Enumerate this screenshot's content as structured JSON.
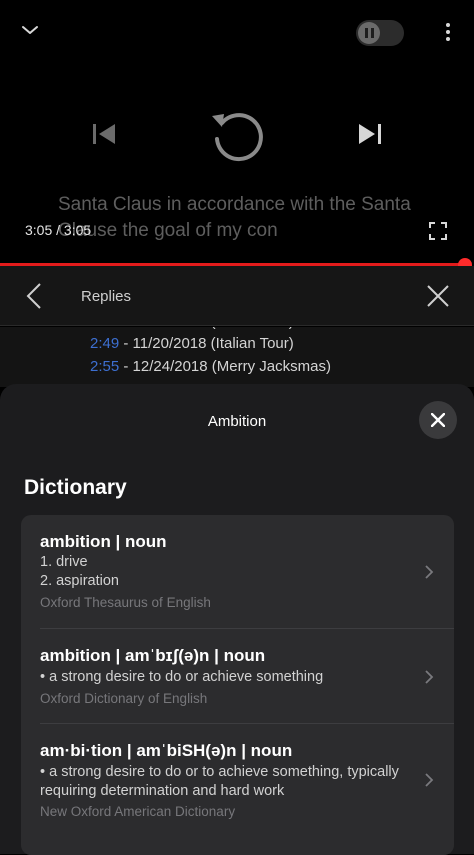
{
  "player": {
    "subtitle": "Santa Claus in accordance with the Santa Clause the goal of my con",
    "time": "3:05 / 3:05",
    "progress_fraction": 0.983
  },
  "replies": {
    "title": "Replies",
    "comments": [
      {
        "timestamp": "2:49",
        "text": " - 11/20/2018 (Italian Tour)"
      },
      {
        "timestamp": "2:55",
        "text": " - 12/24/2018 (Merry Jacksmas)"
      }
    ]
  },
  "sheet": {
    "title": "Ambition",
    "section": "Dictionary",
    "entries": [
      {
        "headword": "ambition  |  noun",
        "definitions": [
          "1. drive",
          "2. aspiration"
        ],
        "source": "Oxford Thesaurus of English"
      },
      {
        "headword": "ambition  |  amˈbɪʃ(ə)n  |  noun",
        "definitions": [
          "• a strong desire to do or achieve something"
        ],
        "source": "Oxford Dictionary of English"
      },
      {
        "headword": "am·bi·tion  |  amˈbiSH(ə)n  |  noun",
        "definitions": [
          "• a strong desire to do or to achieve something, typically requiring determination and hard work"
        ],
        "source": "New Oxford American Dictionary"
      }
    ]
  },
  "colors": {
    "accent_red": "#e31b1b",
    "timestamp_blue": "#3d6fd0",
    "sheet_bg": "#1c1c1e",
    "card_bg": "#2c2c2e"
  },
  "icons": [
    "chevron-down-icon",
    "pause-icon",
    "more-vert-icon",
    "skip-previous-icon",
    "replay-icon",
    "skip-next-icon",
    "fullscreen-icon",
    "chevron-left-icon",
    "close-icon",
    "chevron-right-icon"
  ]
}
